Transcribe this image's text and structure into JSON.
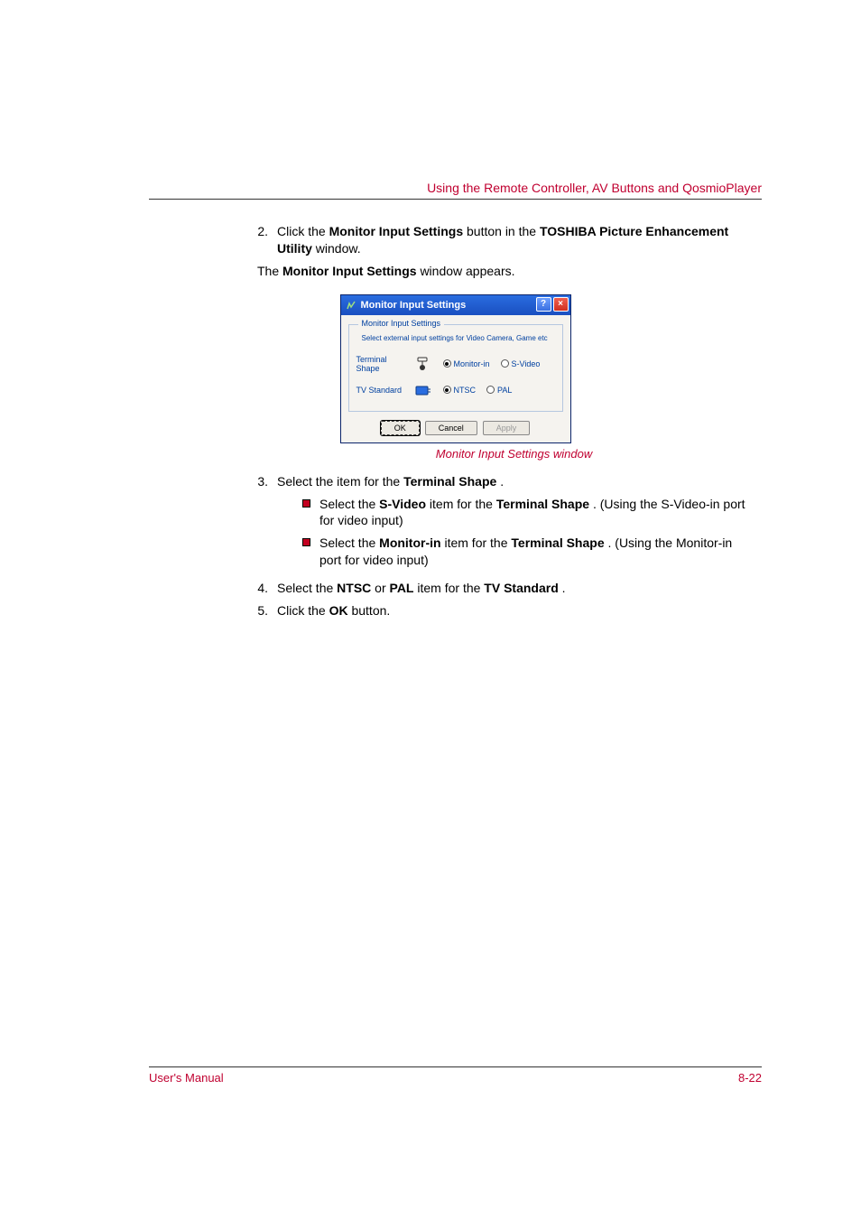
{
  "header_right": "Using the Remote Controller, AV Buttons and QosmioPlayer",
  "steps": {
    "s2": {
      "num": "2.",
      "prefix": "Click the ",
      "b1": "Monitor Input Settings",
      "mid1": " button in the ",
      "b2": "TOSHIBA Picture Enhancement Utility",
      "suffix": " window."
    },
    "after2": {
      "prefix": "The ",
      "b1": "Monitor Input Settings",
      "suffix": " window appears."
    },
    "s3": {
      "num": "3.",
      "prefix": "Select the item for the ",
      "b1": "Terminal Shape",
      "suffix": "."
    },
    "s3a": {
      "prefix": "Select the ",
      "b1": "S-Video",
      "mid1": " item for the ",
      "b2": "Terminal Shape",
      "suffix": ". (Using the S-Video-in port for video input)"
    },
    "s3b": {
      "prefix": "Select the ",
      "b1": "Monitor-in",
      "mid1": " item for the ",
      "b2": "Terminal Shape",
      "suffix": ". (Using the Monitor-in port for video input)"
    },
    "s4": {
      "num": "4.",
      "prefix": "Select the ",
      "b1": "NTSC",
      "mid1": " or ",
      "b2": "PAL",
      "mid2": " item for the ",
      "b3": "TV Standard",
      "suffix": "."
    },
    "s5": {
      "num": "5.",
      "prefix": "Click the ",
      "b1": "OK",
      "suffix": " button."
    }
  },
  "dialog": {
    "title": "Monitor Input Settings",
    "help": "?",
    "close": "×",
    "group_title": "Monitor Input Settings",
    "group_desc": "Select external input settings for Video Camera, Game etc",
    "row1_label": "Terminal Shape",
    "row1_opt1": "Monitor-in",
    "row1_opt2": "S-Video",
    "row2_label": "TV Standard",
    "row2_opt1": "NTSC",
    "row2_opt2": "PAL",
    "btn_ok": "OK",
    "btn_cancel": "Cancel",
    "btn_apply": "Apply"
  },
  "caption": "Monitor Input Settings window",
  "footer_left": "User's Manual",
  "footer_right": "8-22"
}
